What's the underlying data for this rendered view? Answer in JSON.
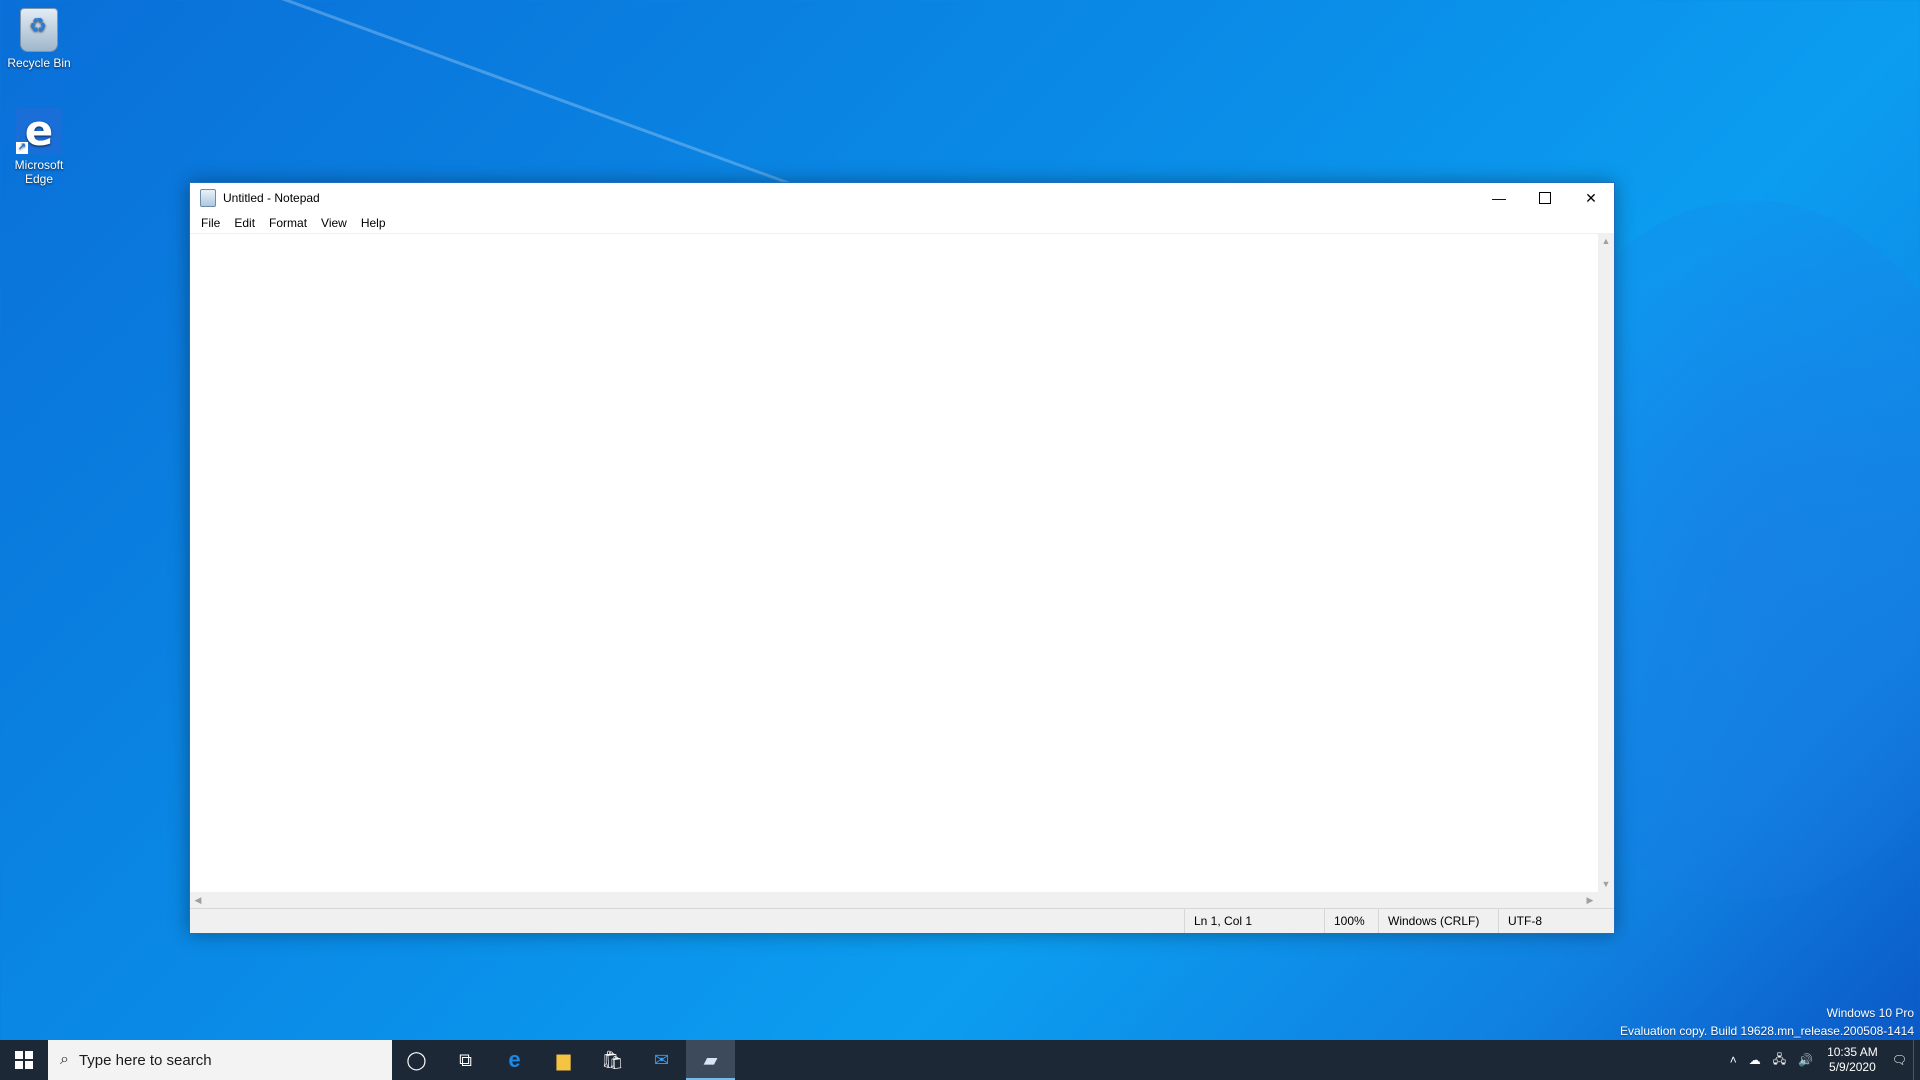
{
  "desktop": {
    "icons": [
      {
        "label": "Recycle Bin"
      },
      {
        "label": "Microsoft Edge"
      }
    ]
  },
  "notepad": {
    "title": "Untitled - Notepad",
    "menu": [
      "File",
      "Edit",
      "Format",
      "View",
      "Help"
    ],
    "content": "",
    "status": {
      "position": "Ln 1, Col 1",
      "zoom": "100%",
      "line_endings": "Windows (CRLF)",
      "encoding": "UTF-8"
    }
  },
  "watermark": {
    "edition": "Windows 10 Pro",
    "build": "Evaluation copy. Build 19628.mn_release.200508-1414"
  },
  "taskbar": {
    "search_placeholder": "Type here to search",
    "time": "10:35 AM",
    "date": "5/9/2020",
    "active_app": "notepad"
  },
  "colors": {
    "desktop_accent": "#0a8ae6",
    "taskbar_bg": "#1d2836",
    "active_indicator": "#76b9ed"
  }
}
